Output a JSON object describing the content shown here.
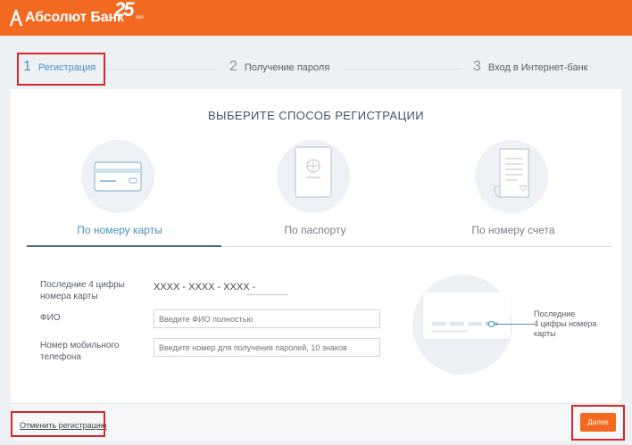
{
  "header": {
    "brand_name": "Абсолют Банк",
    "anniversary_number": "25",
    "anniversary_suffix": "лет"
  },
  "steps": [
    {
      "number": "1",
      "label": "Регистрация",
      "active": true
    },
    {
      "number": "2",
      "label": "Получение пароля",
      "active": false
    },
    {
      "number": "3",
      "label": "Вход в Интернет-банк",
      "active": false
    }
  ],
  "main": {
    "title": "ВЫБЕРИТЕ СПОСОБ РЕГИСТРАЦИИ",
    "methods": [
      {
        "label": "По номеру карты",
        "icon": "bank-card-icon",
        "active": true
      },
      {
        "label": "По паспорту",
        "icon": "passport-icon",
        "active": false
      },
      {
        "label": "По номеру счета",
        "icon": "account-document-icon",
        "active": false
      }
    ]
  },
  "form": {
    "card_digits_label_1": "Последние 4 цифры",
    "card_digits_label_2": "номера карты",
    "card_mask": "XXXX - XXXX - XXXX -",
    "fio_label": "ФИО",
    "fio_placeholder": "Введите ФИО полностью",
    "phone_label_1": "Номер мобильного",
    "phone_label_2": "телефона",
    "phone_placeholder": "Введите номер для получения паролей, 10 знаков"
  },
  "illustration": {
    "note_1": "Последние",
    "note_2": "4 цифры номера",
    "note_3": "карты"
  },
  "footer": {
    "cancel_label": "Отменить регистрацию",
    "next_label": "Далее"
  },
  "colors": {
    "brand_orange": "#f26a21",
    "accent_blue": "#4a90c2",
    "highlight_red": "#d9262c"
  }
}
